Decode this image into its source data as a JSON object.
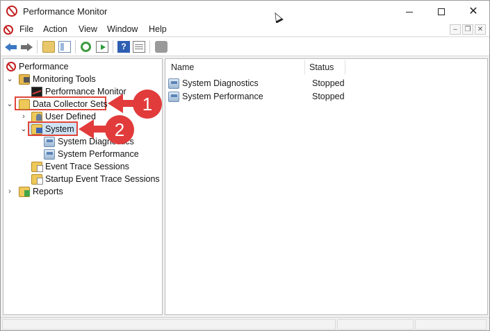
{
  "window": {
    "title": "Performance Monitor",
    "controls": {
      "minimize": "—",
      "maximize": "☐",
      "close": "✕"
    }
  },
  "menu": {
    "items": [
      "File",
      "Action",
      "View",
      "Window",
      "Help"
    ],
    "mdi_controls": [
      "–",
      "❐",
      "✕"
    ]
  },
  "toolbar": {
    "buttons": [
      "back-icon",
      "forward-icon",
      "folder-up-icon",
      "show-hide-tree-icon",
      "refresh-icon",
      "export-list-icon",
      "help-icon",
      "properties-icon",
      "action-icon"
    ]
  },
  "tree": {
    "root": "Performance",
    "monitoring_tools": "Monitoring Tools",
    "performance_monitor": "Performance Monitor",
    "data_collector_sets": "Data Collector Sets",
    "user_defined": "User Defined",
    "system": "System",
    "system_diagnostics": "System Diagnostics",
    "system_performance": "System Performance",
    "event_trace_sessions": "Event Trace Sessions",
    "startup_event_trace_sessions": "Startup Event Trace Sessions",
    "reports": "Reports"
  },
  "list": {
    "columns": {
      "name": "Name",
      "status": "Status"
    },
    "rows": [
      {
        "name": "System Diagnostics",
        "status": "Stopped"
      },
      {
        "name": "System Performance",
        "status": "Stopped"
      }
    ]
  },
  "annotations": {
    "callout_1": "1",
    "callout_2": "2",
    "highlight_color": "#e0453a",
    "callout_color": "#e23b3b"
  }
}
